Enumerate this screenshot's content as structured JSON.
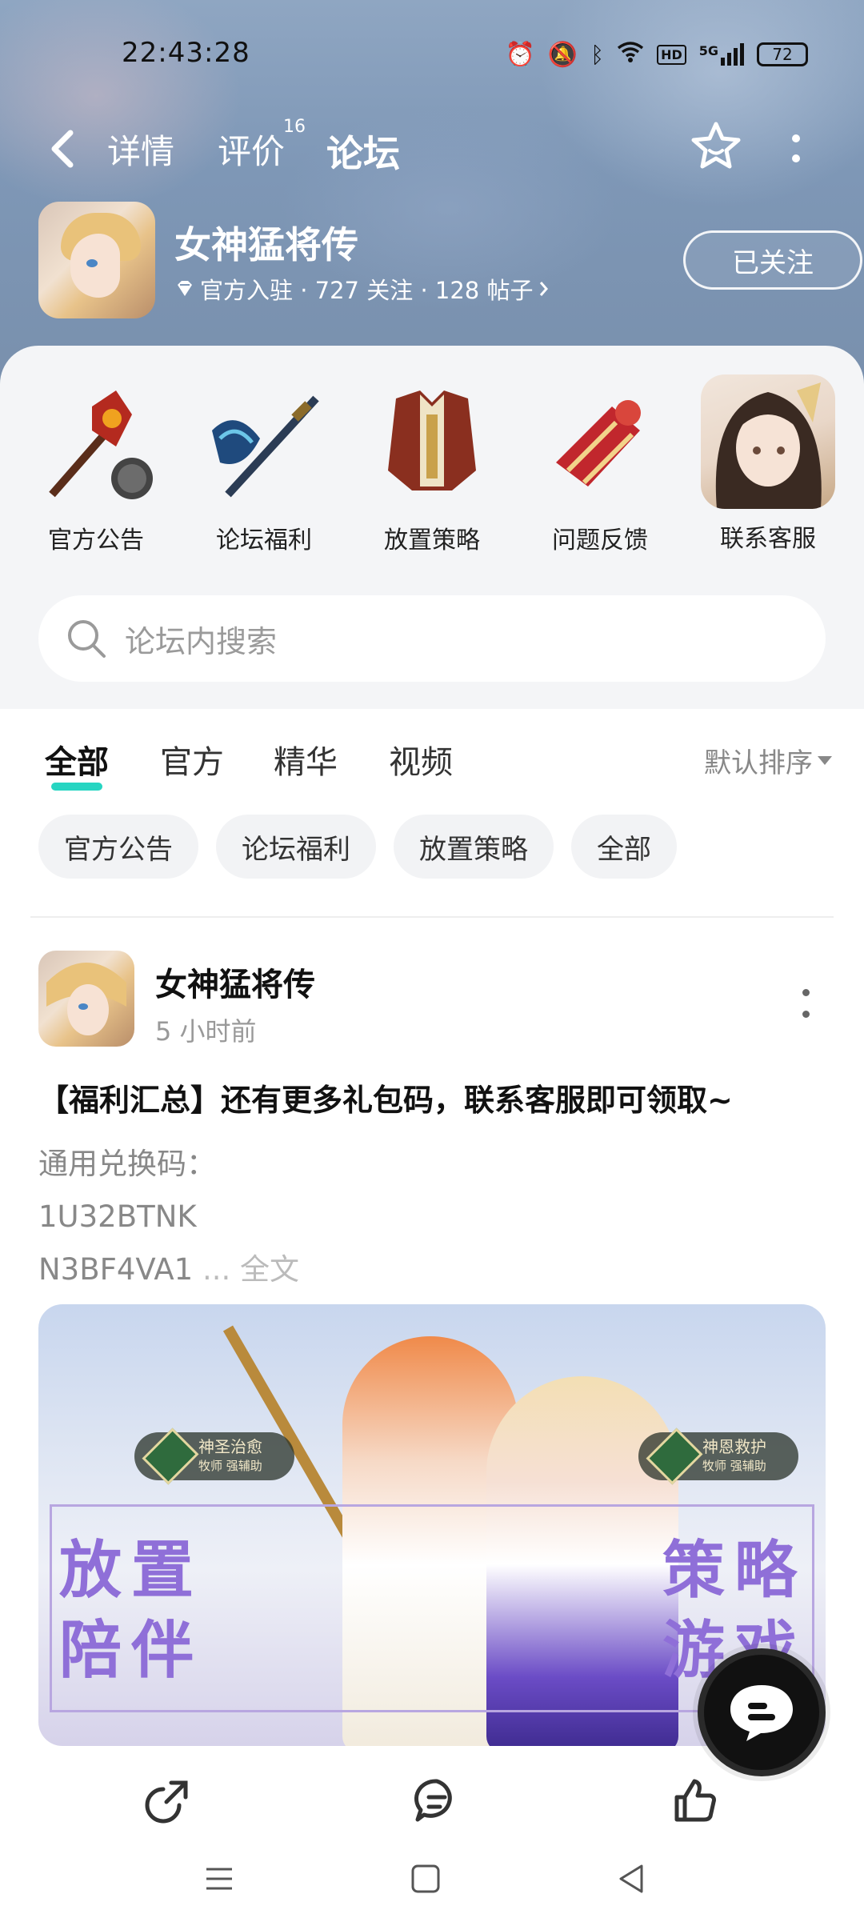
{
  "status_bar": {
    "time": "22:43:28",
    "battery": "72",
    "network": "5G",
    "hd": "HD"
  },
  "nav": {
    "tabs": [
      {
        "label": "详情"
      },
      {
        "label": "评价",
        "badge": "16"
      },
      {
        "label": "论坛",
        "active": true
      }
    ]
  },
  "game": {
    "title": "女神猛将传",
    "meta": "官方入驻 · 727 关注 · 128 帖子",
    "follow_label": "已关注"
  },
  "categories": [
    {
      "label": "官方公告",
      "icon": "mace-icon"
    },
    {
      "label": "论坛福利",
      "icon": "axe-icon"
    },
    {
      "label": "放置策略",
      "icon": "armor-icon"
    },
    {
      "label": "问题反馈",
      "icon": "gauntlet-icon"
    },
    {
      "label": "联系客服",
      "icon": "service-avatar"
    }
  ],
  "search": {
    "placeholder": "论坛内搜索"
  },
  "filter": {
    "tabs": [
      {
        "label": "全部",
        "active": true
      },
      {
        "label": "官方"
      },
      {
        "label": "精华"
      },
      {
        "label": "视频"
      }
    ],
    "sort_label": "默认排序"
  },
  "chips": [
    "官方公告",
    "论坛福利",
    "放置策略",
    "全部"
  ],
  "post": {
    "author": "女神猛将传",
    "time": "5 小时前",
    "title": "【福利汇总】还有更多礼包码，联系客服即可领取~",
    "body_lines": [
      "通用兑换码：",
      "1U32BTNK",
      "N3BF4VA1"
    ],
    "more_text": " ... 全文",
    "image": {
      "badge_left": "神圣治愈",
      "badge_left_sub": "牧师 强辅助",
      "badge_right": "神恩救护",
      "badge_right_sub": "牧师 强辅助",
      "words_left": [
        "放",
        "置",
        "陪",
        "伴"
      ],
      "words_right": [
        "策",
        "略",
        "游",
        "戏"
      ]
    }
  },
  "colors": {
    "accent": "#27d5c2",
    "chip_bg": "#f2f3f5",
    "panel_bg": "#f4f5f7",
    "purple_text": "#8f6fd8"
  }
}
